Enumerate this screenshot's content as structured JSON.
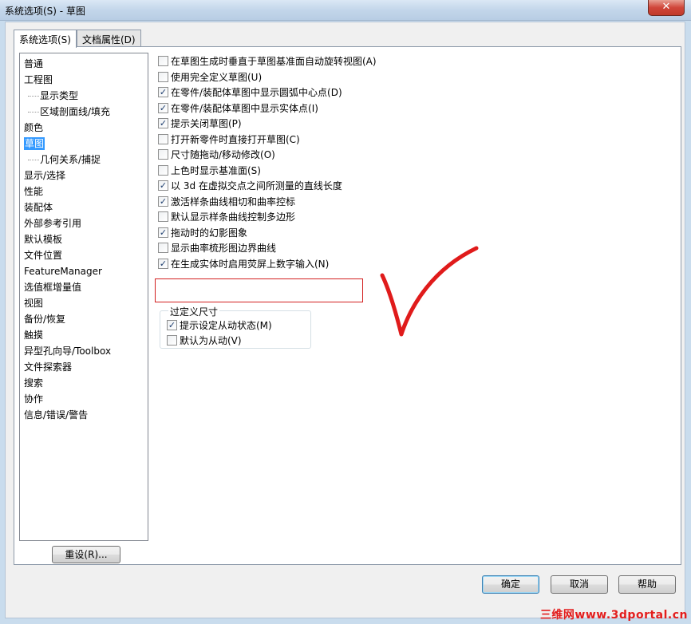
{
  "window": {
    "title": "系统选项(S) - 草图",
    "close_glyph": "✕"
  },
  "tabs": [
    {
      "label": "系统选项(S)"
    },
    {
      "label": "文档属性(D)"
    }
  ],
  "tree": {
    "items": [
      {
        "label": "普通"
      },
      {
        "label": "工程图"
      },
      {
        "label": "显示类型"
      },
      {
        "label": "区域剖面线/填充"
      },
      {
        "label": "颜色"
      },
      {
        "label": "草图"
      },
      {
        "label": "几何关系/捕捉"
      },
      {
        "label": "显示/选择"
      },
      {
        "label": "性能"
      },
      {
        "label": "装配体"
      },
      {
        "label": "外部参考引用"
      },
      {
        "label": "默认模板"
      },
      {
        "label": "文件位置"
      },
      {
        "label": "FeatureManager"
      },
      {
        "label": "选值框增量值"
      },
      {
        "label": "视图"
      },
      {
        "label": "备份/恢复"
      },
      {
        "label": "触摸"
      },
      {
        "label": "异型孔向导/Toolbox"
      },
      {
        "label": "文件探索器"
      },
      {
        "label": "搜索"
      },
      {
        "label": "协作"
      },
      {
        "label": "信息/错误/警告"
      }
    ],
    "reset_label": "重设(R)..."
  },
  "options": [
    {
      "label": "在草图生成时垂直于草图基准面自动旋转视图(A)",
      "checked": false
    },
    {
      "label": "使用完全定义草图(U)",
      "checked": false
    },
    {
      "label": "在零件/装配体草图中显示圆弧中心点(D)",
      "checked": true
    },
    {
      "label": "在零件/装配体草图中显示实体点(I)",
      "checked": true
    },
    {
      "label": "提示关闭草图(P)",
      "checked": true
    },
    {
      "label": "打开新零件时直接打开草图(C)",
      "checked": false
    },
    {
      "label": "尺寸随拖动/移动修改(O)",
      "checked": false
    },
    {
      "label": "上色时显示基准面(S)",
      "checked": false
    },
    {
      "label": "以 3d 在虚拟交点之间所测量的直线长度",
      "checked": true
    },
    {
      "label": "激活样条曲线相切和曲率控标",
      "checked": true
    },
    {
      "label": "默认显示样条曲线控制多边形",
      "checked": false
    },
    {
      "label": "拖动时的幻影图象",
      "checked": true
    },
    {
      "label": "显示曲率梳形图边界曲线",
      "checked": false
    },
    {
      "label": "在生成实体时启用荧屏上数字输入(N)",
      "checked": true
    }
  ],
  "overdefined": {
    "legend": "过定义尺寸",
    "options": [
      {
        "label": "提示设定从动状态(M)",
        "checked": true
      },
      {
        "label": "默认为从动(V)",
        "checked": false
      }
    ]
  },
  "footer": {
    "ok_label": "确定",
    "cancel_label": "取消",
    "help_label": "帮助"
  },
  "watermark": "三维网www.3dportal.cn",
  "colors": {
    "annotation_red": "#e01b1b",
    "selection_blue": "#3399ff"
  }
}
